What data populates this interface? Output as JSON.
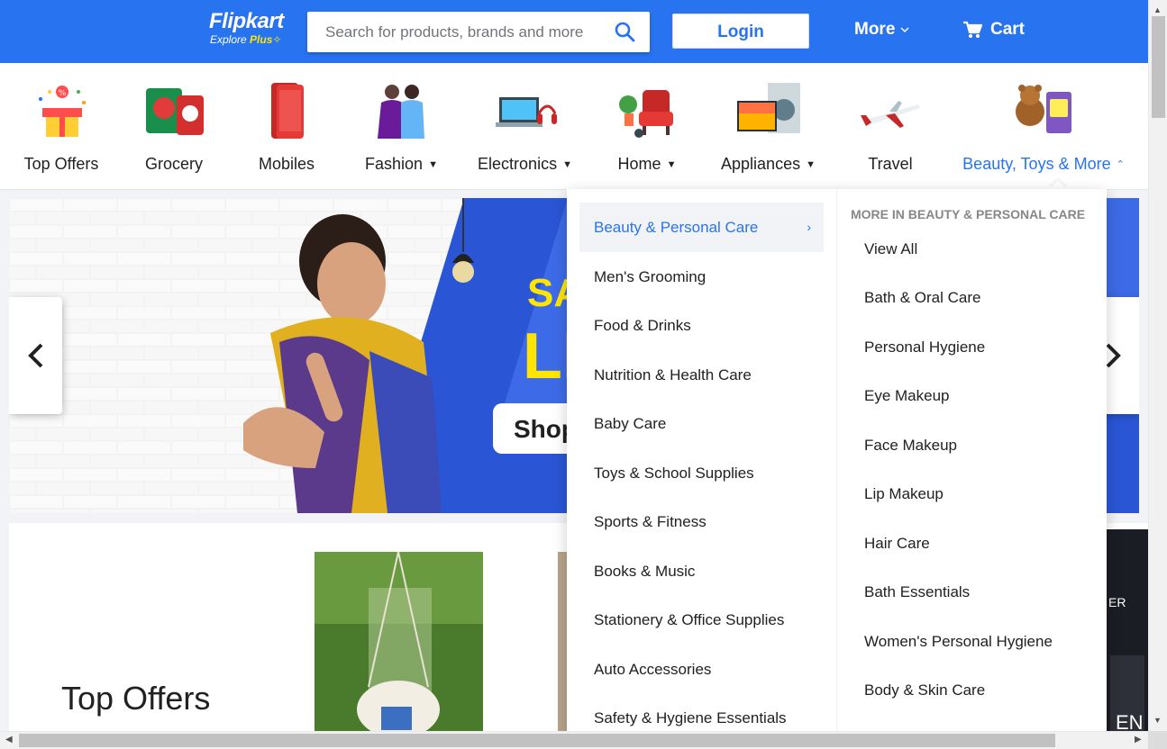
{
  "header": {
    "logo_main": "Flipkart",
    "logo_sub_prefix": "Explore",
    "logo_sub_plus": "Plus",
    "search_placeholder": "Search for products, brands and more",
    "login_label": "Login",
    "more_label": "More",
    "cart_label": "Cart",
    "brand_color": "#2874f0"
  },
  "categories": [
    {
      "label": "Top Offers",
      "icon": "gift-box-icon"
    },
    {
      "label": "Grocery",
      "icon": "grocery-pack-icon"
    },
    {
      "label": "Mobiles",
      "icon": "smartphone-icon"
    },
    {
      "label": "Fashion",
      "icon": "fashion-models-icon"
    },
    {
      "label": "Electronics",
      "icon": "laptop-headphones-icon"
    },
    {
      "label": "Home",
      "icon": "armchair-icon"
    },
    {
      "label": "Appliances",
      "icon": "tv-washing-machine-icon"
    },
    {
      "label": "Travel",
      "icon": "airplane-icon"
    },
    {
      "label": "Beauty, Toys & More",
      "icon": "teddy-bear-icon"
    }
  ],
  "dropdown": {
    "left_items": [
      "Beauty & Personal Care",
      "Men's Grooming",
      "Food & Drinks",
      "Nutrition & Health Care",
      "Baby Care",
      "Toys & School Supplies",
      "Sports & Fitness",
      "Books & Music",
      "Stationery & Office Supplies",
      "Auto Accessories",
      "Safety & Hygiene Essentials"
    ],
    "right_heading": "MORE IN BEAUTY & PERSONAL CARE",
    "right_items": [
      "View All",
      "Bath & Oral Care",
      "Personal Hygiene",
      "Eye Makeup",
      "Face Makeup",
      "Lip Makeup",
      "Hair Care",
      "Bath Essentials",
      "Women's Personal Hygiene",
      "Body & Skin Care"
    ]
  },
  "banner": {
    "text_fragment_1": "SA",
    "text_fragment_2": "LI",
    "button_fragment": "Shop"
  },
  "offers": {
    "title": "Top Offers"
  },
  "offer_fragment_text": "ER"
}
